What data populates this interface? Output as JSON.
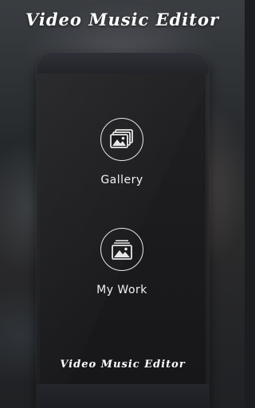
{
  "header": {
    "title": "Video Music Editor"
  },
  "menu": {
    "gallery": {
      "label": "Gallery",
      "icon": "gallery-stack-icon"
    },
    "my_work": {
      "label": "My Work",
      "icon": "photo-album-icon"
    }
  },
  "footer": {
    "title": "Video Music Editor"
  },
  "colors": {
    "text": "#ffffff",
    "icon_stroke": "#e8e8e8",
    "frame": "#23242a"
  }
}
